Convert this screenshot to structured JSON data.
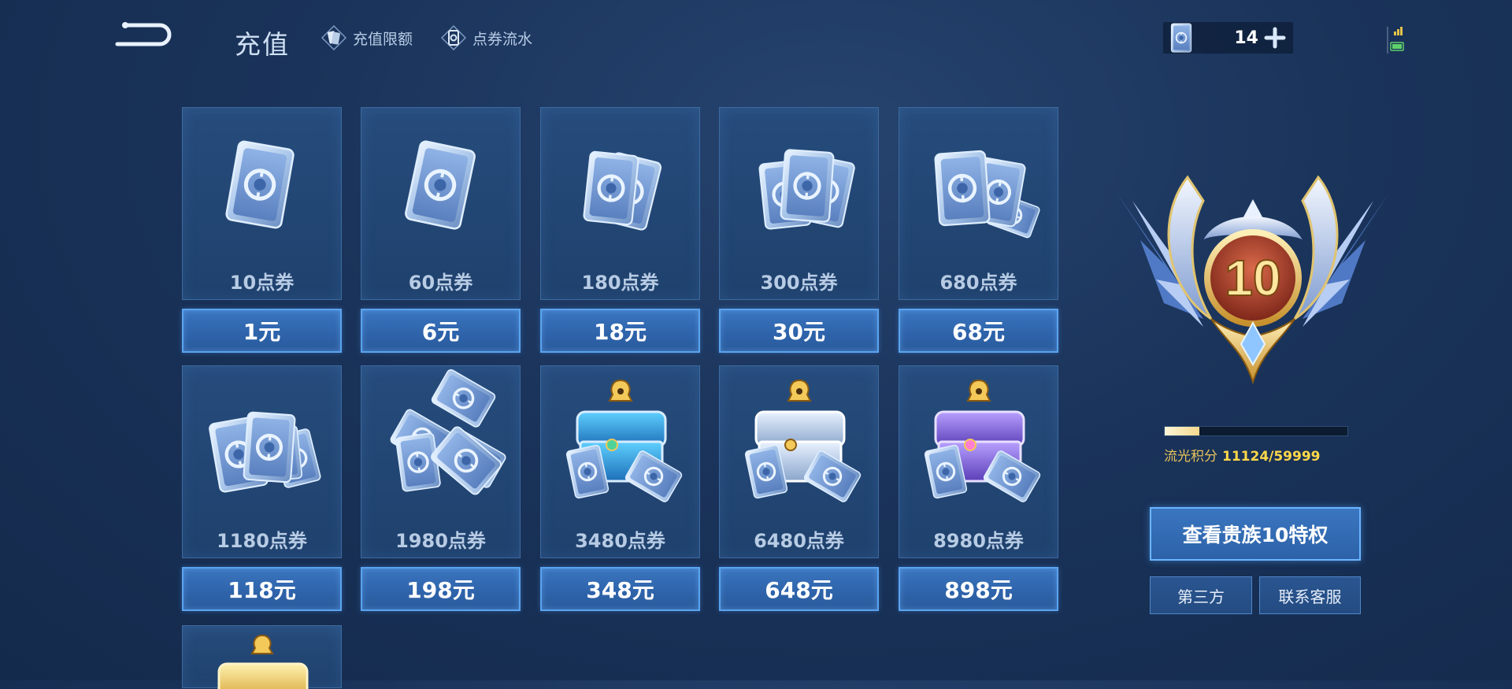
{
  "header": {
    "title": "充值",
    "links": [
      {
        "label": "充值限额",
        "icon": "coupon-card-icon"
      },
      {
        "label": "点券流水",
        "icon": "coupon-flow-icon"
      }
    ],
    "balance": {
      "value": "14",
      "icon": "coupon-icon"
    }
  },
  "products": [
    {
      "qty": "10点券",
      "price": "1元"
    },
    {
      "qty": "60点券",
      "price": "6元"
    },
    {
      "qty": "180点券",
      "price": "18元"
    },
    {
      "qty": "300点券",
      "price": "30元"
    },
    {
      "qty": "680点券",
      "price": "68元"
    },
    {
      "qty": "1180点券",
      "price": "118元"
    },
    {
      "qty": "1980点券",
      "price": "198元"
    },
    {
      "qty": "3480点券",
      "price": "348元"
    },
    {
      "qty": "6480点券",
      "price": "648元"
    },
    {
      "qty": "8980点券",
      "price": "898元"
    }
  ],
  "vip": {
    "level": "10",
    "score_label": "流光积分",
    "score_value": "11124/59999",
    "progress": 0.19,
    "noble_button": "查看贵族10特权",
    "third_party_button": "第三方",
    "service_button": "联系客服"
  },
  "colors": {
    "background": "#1a335a",
    "button_blue": "#2e63aa",
    "button_border": "#5aa3f0",
    "score_gold": "#ffd84a"
  }
}
